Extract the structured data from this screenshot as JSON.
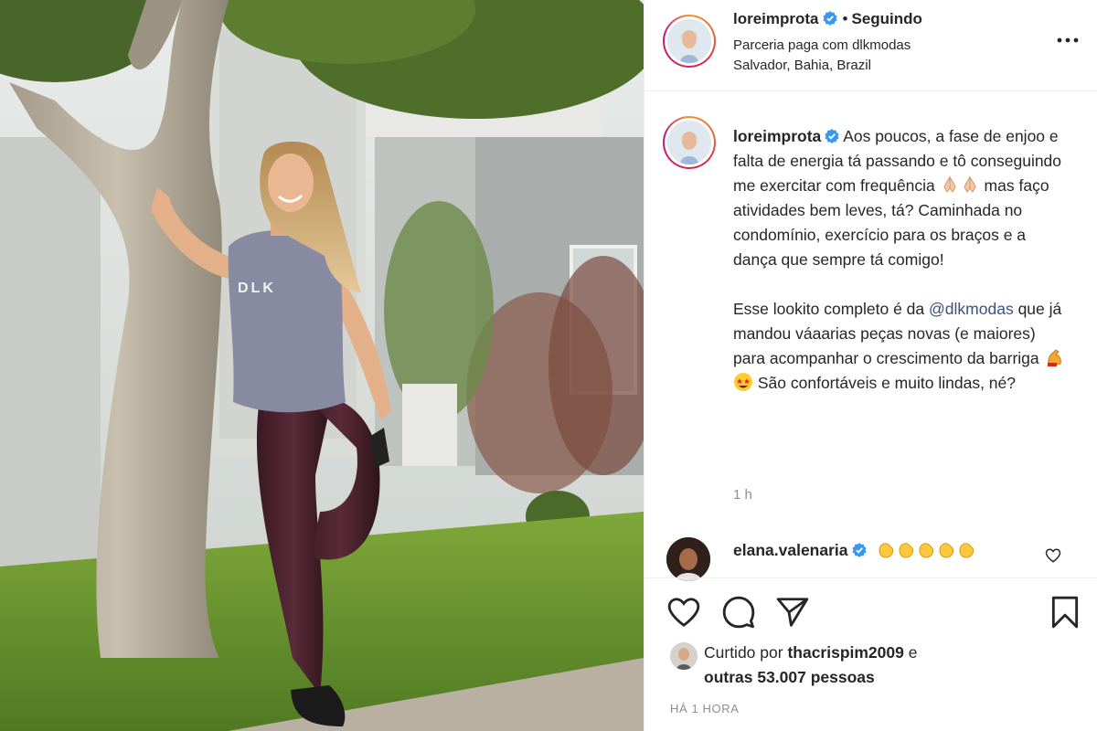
{
  "post": {
    "username": "loreimprota",
    "follow_status": "Seguindo",
    "partnership_prefix": "Parceria paga com ",
    "partnership_brand": "dlkmodas",
    "location": "Salvador, Bahia, Brazil",
    "shirt_logo": "DLK"
  },
  "caption": {
    "username": "loreimprota",
    "p1_text": "Aos poucos, a fase de enjoo e falta de energia tá passando e tô conseguindo me exercitar com frequência",
    "p1_emoji": "folded-hands x2",
    "p1_text2": "mas faço atividades bem leves, tá? Caminhada no condomínio, exercício para os braços e a dança que sempre tá comigo!",
    "p2_text": "Esse lookito completo é da",
    "p2_mention": "@dlkmodas",
    "p2_text2": "que já mandou váaarias peças novas (e maiores) para acompanhar o crescimento da barriga",
    "p2_emoji": "flexed-biceps, star-struck",
    "p2_text3": "São confortáveis e muito lindas, né?",
    "time": "1 h"
  },
  "comment": {
    "username": "elana.valenaria",
    "emoji": "clapping-hands x5"
  },
  "actions": {
    "liked_by_prefix": "Curtido por ",
    "liked_by_user": "thacrispim2009",
    "liked_by_suffix": " e",
    "others": "outras 53.007 pessoas",
    "posted_ago": "HÁ 1 HORA"
  },
  "icons": {
    "more": "more-horizontal-icon",
    "like": "heart-icon",
    "comment": "comment-bubble-icon",
    "share": "paper-plane-icon",
    "save": "bookmark-icon",
    "verified": "verified-badge-icon"
  },
  "colors": {
    "verified": "#3897f0",
    "link": "#385185",
    "muted": "#8e8e8e",
    "text": "#262626"
  }
}
